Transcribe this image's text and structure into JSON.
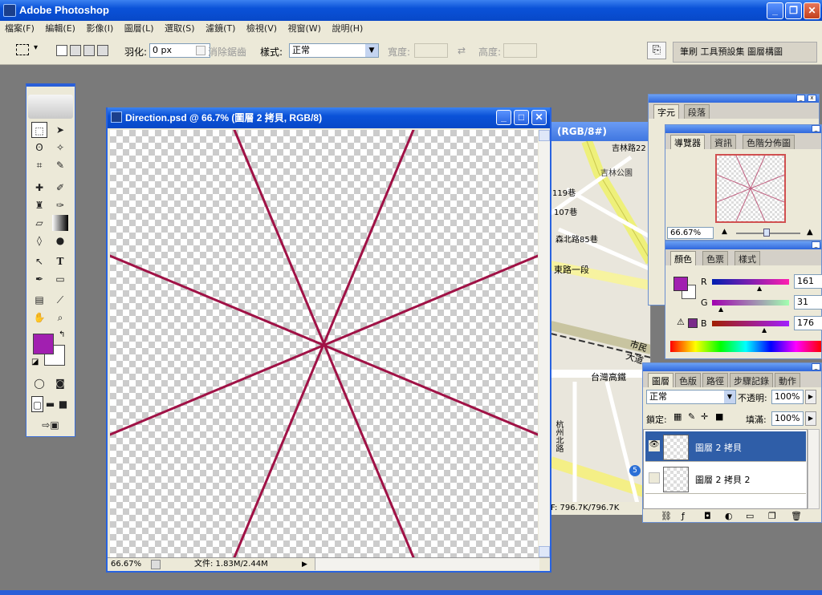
{
  "app": {
    "title": "Adobe Photoshop"
  },
  "menu": [
    "檔案(F)",
    "編輯(E)",
    "影像(I)",
    "圖層(L)",
    "選取(S)",
    "濾鏡(T)",
    "檢視(V)",
    "視窗(W)",
    "說明(H)"
  ],
  "options": {
    "feather_label": "羽化:",
    "feather_value": "0 px",
    "antialias_label": "消除鋸齒",
    "style_label": "樣式:",
    "style_value": "正常",
    "width_label": "寬度:",
    "height_label": "高度:",
    "palette_tabs": "筆刷 工具預設集 圖層構圖"
  },
  "document": {
    "title": "Direction.psd @ 66.7% (圖層 2 拷貝, RGB/8)",
    "zoom": "66.67%",
    "status": "文件: 1.83M/2.44M"
  },
  "map_window": {
    "title": "(RGB/8#)",
    "status": "F: 796.7K/796.7K",
    "labels": [
      "吉林路22",
      "吉林公園",
      "119巷",
      "107巷",
      "森北路85巷",
      "東路一段",
      "市民大道",
      "台灣高鐵",
      "杭州北路",
      "5"
    ]
  },
  "char_panel": {
    "tabs": [
      "字元",
      "段落"
    ]
  },
  "navigator": {
    "tabs": [
      "導覽器",
      "資訊",
      "色階分佈圖"
    ],
    "zoom": "66.67%"
  },
  "color_panel": {
    "tabs": [
      "顏色",
      "色票",
      "樣式"
    ],
    "r_label": "R",
    "g_label": "G",
    "b_label": "B",
    "r": "161",
    "g": "31",
    "b": "176",
    "r_fraction": 0.63,
    "g_fraction": 0.12,
    "b_fraction": 0.69,
    "foreground": "#a11fb0"
  },
  "layers_panel": {
    "tabs": [
      "圖層",
      "色版",
      "路徑",
      "步驟記錄",
      "動作"
    ],
    "blend_mode": "正常",
    "opacity_label": "不透明:",
    "opacity": "100%",
    "lock_label": "鎖定:",
    "fill_label": "填滿:",
    "fill": "100%",
    "layers": [
      {
        "name": "圖層 2 拷貝",
        "visible": true,
        "selected": true
      },
      {
        "name": "圖層 2 拷貝 2",
        "visible": false,
        "selected": false
      }
    ]
  },
  "colors": {
    "title_blue": "#0a52d8",
    "line_color": "#a01246",
    "layer_selected": "#2f5ea8"
  }
}
